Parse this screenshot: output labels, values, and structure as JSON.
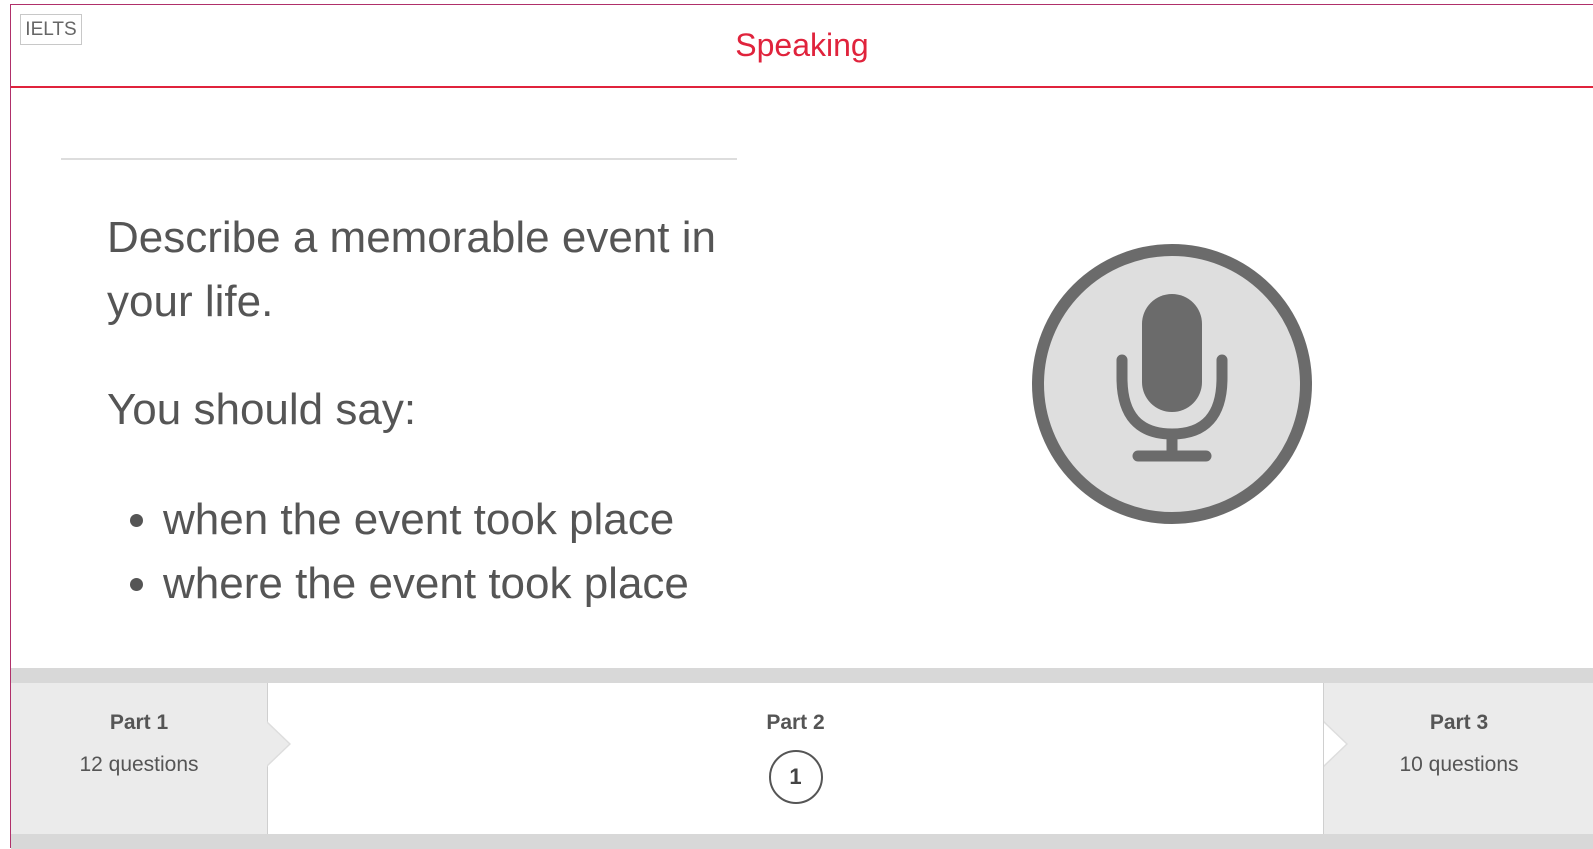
{
  "header": {
    "logo": "IELTS",
    "title": "Speaking"
  },
  "prompt": {
    "task": "Describe a memorable event in your life.",
    "instruction": "You should say:",
    "points": [
      "when the event took place",
      "where the event took place"
    ]
  },
  "mic": {
    "icon": "microphone-icon"
  },
  "footer": {
    "parts": [
      {
        "title": "Part 1",
        "subtitle": "12 questions"
      },
      {
        "title": "Part 2",
        "question_number": "1"
      },
      {
        "title": "Part 3",
        "subtitle": "10 questions"
      }
    ]
  },
  "colors": {
    "accent": "#e0233c",
    "text": "#555555",
    "mic_ring": "#6b6b6b",
    "mic_fill": "#dedede"
  }
}
